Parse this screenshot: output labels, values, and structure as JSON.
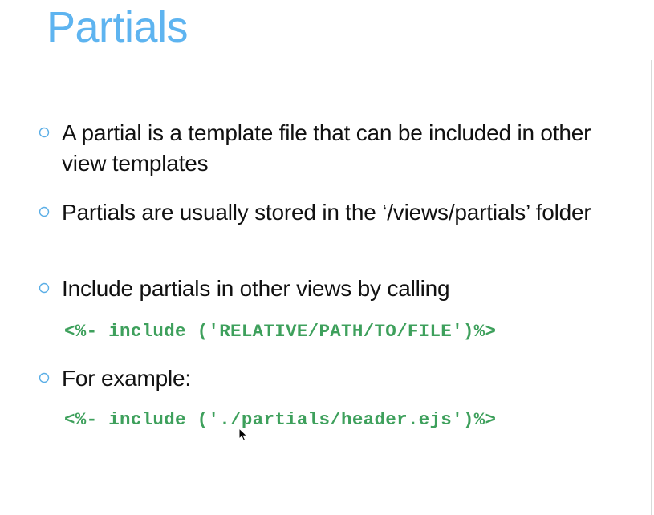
{
  "slide": {
    "title": "Partials",
    "bullets": [
      {
        "text": "A partial is a template file that can be included in other view templates"
      },
      {
        "text": "Partials are usually stored in the ‘/views/partials’ folder"
      },
      {
        "text": "Include partials in other views by calling"
      },
      {
        "text": "For example:"
      }
    ],
    "code_examples": [
      "<%- include ('RELATIVE/PATH/TO/FILE')%>",
      "<%- include ('./partials/header.ejs')%>"
    ]
  },
  "colors": {
    "title": "#5eb4f0",
    "bullet_marker": "#5aaee6",
    "code": "#3ea05c",
    "body_text": "#111111"
  },
  "icons": {
    "bullet": "hollow-circle-bullet-icon",
    "cursor": "mouse-pointer-icon"
  }
}
